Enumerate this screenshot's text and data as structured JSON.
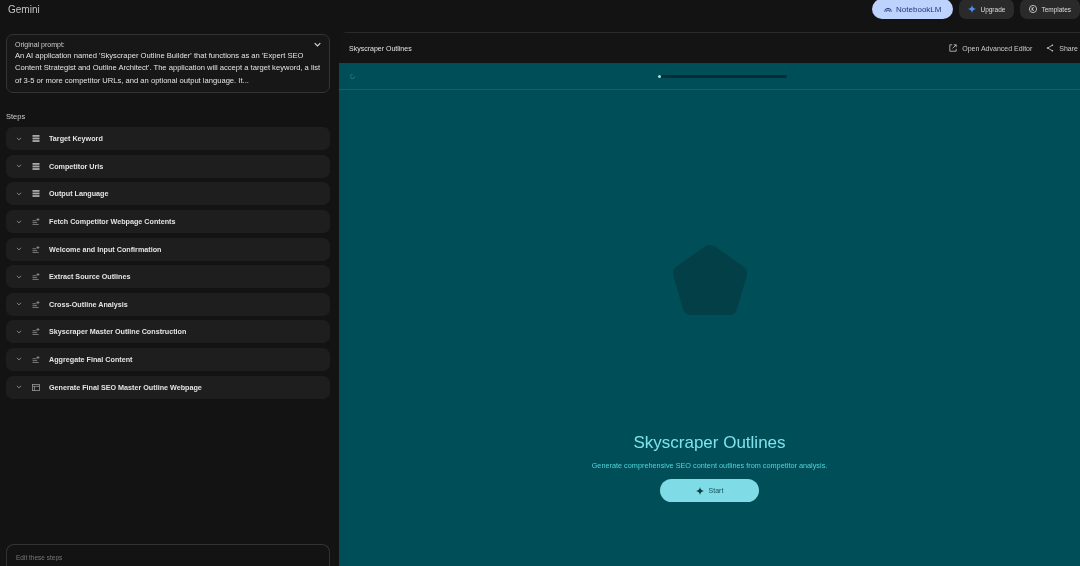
{
  "app_title": "Gemini",
  "top_buttons": [
    {
      "label": "NotebookLM",
      "kind": "primary"
    },
    {
      "label": "Upgrade",
      "kind": "upgrade"
    },
    {
      "label": "Templates",
      "kind": "templates"
    }
  ],
  "prompt": {
    "label": "Original prompt:",
    "expanded": false,
    "text": "An AI application named 'Skyscraper Outline Builder' that functions as an 'Expert SEO Content Strategist and Outline Architect'. The application will accept a target keyword, a list of 3-5 or more competitor URLs, and an optional output language. It..."
  },
  "steps_heading": "Steps",
  "steps": [
    {
      "label": "Target Keyword",
      "kind": "input"
    },
    {
      "label": "Competitor Urls",
      "kind": "input"
    },
    {
      "label": "Output Language",
      "kind": "input"
    },
    {
      "label": "Fetch Competitor Webpage Contents",
      "kind": "step"
    },
    {
      "label": "Welcome and Input Confirmation",
      "kind": "step"
    },
    {
      "label": "Extract Source Outlines",
      "kind": "step"
    },
    {
      "label": "Cross-Outline Analysis",
      "kind": "step"
    },
    {
      "label": "Skyscraper Master Outline Construction",
      "kind": "step"
    },
    {
      "label": "Aggregate Final Content",
      "kind": "step"
    },
    {
      "label": "Generate Final SEO Master Outline Webpage",
      "kind": "output"
    }
  ],
  "edit_field": {
    "placeholder": "Edit these steps"
  },
  "preview": {
    "title": "Skyscraper Outlines",
    "actions": [
      {
        "label": "Open Advanced Editor",
        "kind": "open"
      },
      {
        "label": "Share",
        "kind": "share"
      }
    ],
    "progress": {
      "level": 0.02
    },
    "app_heading": "Skyscraper Outlines",
    "app_subtitle": "Generate comprehensive SEO content outlines from competitor analysis.",
    "start_button": "Start"
  }
}
